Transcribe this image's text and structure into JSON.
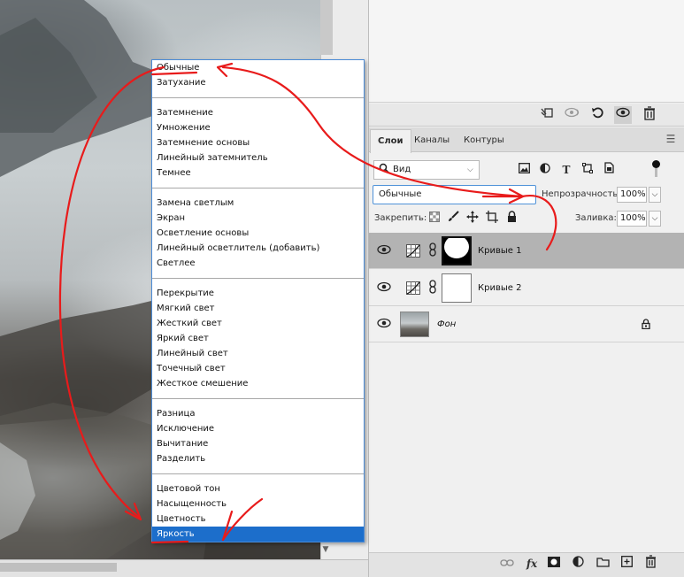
{
  "blend_modes": {
    "groups": [
      [
        "Обычные",
        "Затухание"
      ],
      [
        "Затемнение",
        "Умножение",
        "Затемнение основы",
        "Линейный затемнитель",
        "Темнее"
      ],
      [
        "Замена светлым",
        "Экран",
        "Осветление основы",
        "Линейный осветлитель (добавить)",
        "Светлее"
      ],
      [
        "Перекрытие",
        "Мягкий свет",
        "Жесткий свет",
        "Яркий свет",
        "Линейный свет",
        "Точечный свет",
        "Жесткое смешение"
      ],
      [
        "Разница",
        "Исключение",
        "Вычитание",
        "Разделить"
      ],
      [
        "Цветовой тон",
        "Насыщенность",
        "Цветность",
        "Яркость"
      ]
    ],
    "highlighted": "Яркость"
  },
  "layers_panel": {
    "tabs": [
      "Слои",
      "Каналы",
      "Контуры"
    ],
    "active_tab": "Слои",
    "filter_label": "Вид",
    "blend_mode_value": "Обычные",
    "opacity_label": "Непрозрачность:",
    "opacity_value": "100%",
    "lock_label": "Закрепить:",
    "fill_label": "Заливка:",
    "fill_value": "100%",
    "layers": [
      {
        "name": "Кривые 1",
        "selected": true
      },
      {
        "name": "Кривые 2",
        "selected": false
      },
      {
        "name": "Фон",
        "selected": false
      }
    ]
  },
  "icons": {
    "top_row": [
      "sample-icon",
      "link-eye-icon",
      "reset-icon",
      "visibility-icon",
      "trash-icon"
    ],
    "filter_row": [
      "image-filter-icon",
      "adjustment-filter-icon",
      "type-filter-icon",
      "shape-filter-icon",
      "smart-object-filter-icon"
    ],
    "lock_row": [
      "lock-transparent-icon",
      "lock-brush-icon",
      "lock-move-icon",
      "lock-artboard-icon",
      "lock-all-icon"
    ],
    "bottom_row": [
      "link-layers-icon",
      "fx-icon",
      "add-mask-icon",
      "new-adjustment-icon",
      "new-group-icon",
      "new-layer-icon",
      "delete-layer-icon"
    ]
  },
  "colors": {
    "highlight": "#1c6ecb",
    "annotation": "#e81b1b",
    "selected_layer": "#b3b3b3"
  }
}
